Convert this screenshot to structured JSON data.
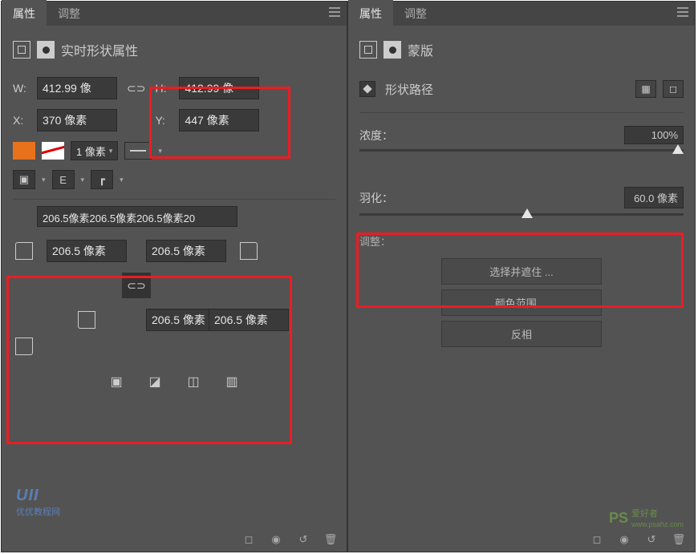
{
  "tabs": {
    "properties": "属性",
    "adjustments": "调整"
  },
  "left": {
    "header": "实时形状属性",
    "W": {
      "label": "W:",
      "value": "412.99 像"
    },
    "H": {
      "label": "H:",
      "value": "412.99 像"
    },
    "X": {
      "label": "X:",
      "value": "370 像素"
    },
    "Y": {
      "label": "Y:",
      "value": "447 像素"
    },
    "stroke_width": "1 像素",
    "corner_long": "206.5像素206.5像素206.5像素20",
    "corner": "206.5 像素",
    "link": "⊂⊃"
  },
  "right": {
    "header": "蒙版",
    "select": "形状路径",
    "density": {
      "label": "浓度：",
      "value": "100%"
    },
    "feather": {
      "label": "羽化：",
      "value": "60.0 像素"
    },
    "adjust": "调整：",
    "btn1": "选择并遮住 ...",
    "btn2": "颜色范围 ...",
    "btn3": "反相"
  },
  "wm1": {
    "brand": "UII",
    "sub": "优优教程网"
  },
  "wm2": {
    "brand": "PS",
    "sub": "爱好者",
    "url": "www.psahz.com"
  }
}
